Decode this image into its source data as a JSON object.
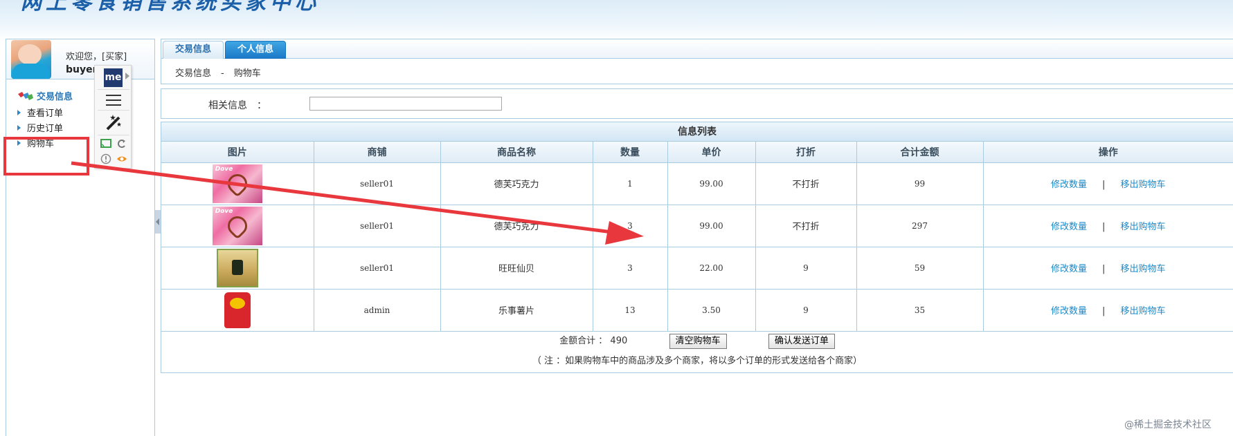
{
  "header": {
    "banner_title": "网上零食销售系统买家中心"
  },
  "user": {
    "welcome": "欢迎您，[买家]",
    "username": "buyer"
  },
  "sidebar": {
    "section_title": "交易信息",
    "items": [
      {
        "label": "查看订单"
      },
      {
        "label": "历史订单"
      },
      {
        "label": "购物车"
      }
    ]
  },
  "extension": {
    "logo_text": "me"
  },
  "tabs": [
    {
      "label": "交易信息",
      "active": true
    },
    {
      "label": "个人信息",
      "active": false
    }
  ],
  "breadcrumb": {
    "first": "交易信息",
    "separator": "-",
    "current": "购物车"
  },
  "filter": {
    "label": "相关信息　：",
    "value": "",
    "placeholder": ""
  },
  "list": {
    "title": "信息列表",
    "columns": [
      "图片",
      "商铺",
      "商品名称",
      "数量",
      "单价",
      "打折",
      "合计金额",
      "操作"
    ],
    "rows": [
      {
        "image": "dove-chocolate",
        "shop": "seller01",
        "name": "德芙巧克力",
        "qty": "1",
        "price": "99.00",
        "discount": "不打折",
        "total": "99"
      },
      {
        "image": "dove-chocolate",
        "shop": "seller01",
        "name": "德芙巧克力",
        "qty": "3",
        "price": "99.00",
        "discount": "不打折",
        "total": "297"
      },
      {
        "image": "wangwang-rice-cracker",
        "shop": "seller01",
        "name": "旺旺仙贝",
        "qty": "3",
        "price": "22.00",
        "discount": "9",
        "total": "59"
      },
      {
        "image": "lays-chips",
        "shop": "admin",
        "name": "乐事薯片",
        "qty": "13",
        "price": "3.50",
        "discount": "9",
        "total": "35"
      }
    ],
    "action_edit": "修改数量",
    "action_sep": "|",
    "action_remove": "移出购物车"
  },
  "summary": {
    "total_label": "金额合计 ： 490",
    "clear_button": "清空购物车",
    "confirm_button": "确认发送订单",
    "note": "（ 注 ：如果购物车中的商品涉及多个商家，将以多个订单的形式发送给各个商家）"
  },
  "watermark": "@稀土掘金技术社区",
  "colors": {
    "accent_blue": "#1d8ac9",
    "border": "#a9cbe2",
    "annotation_red": "#e8383d",
    "tab_active_blue": "#1b7ac8"
  }
}
